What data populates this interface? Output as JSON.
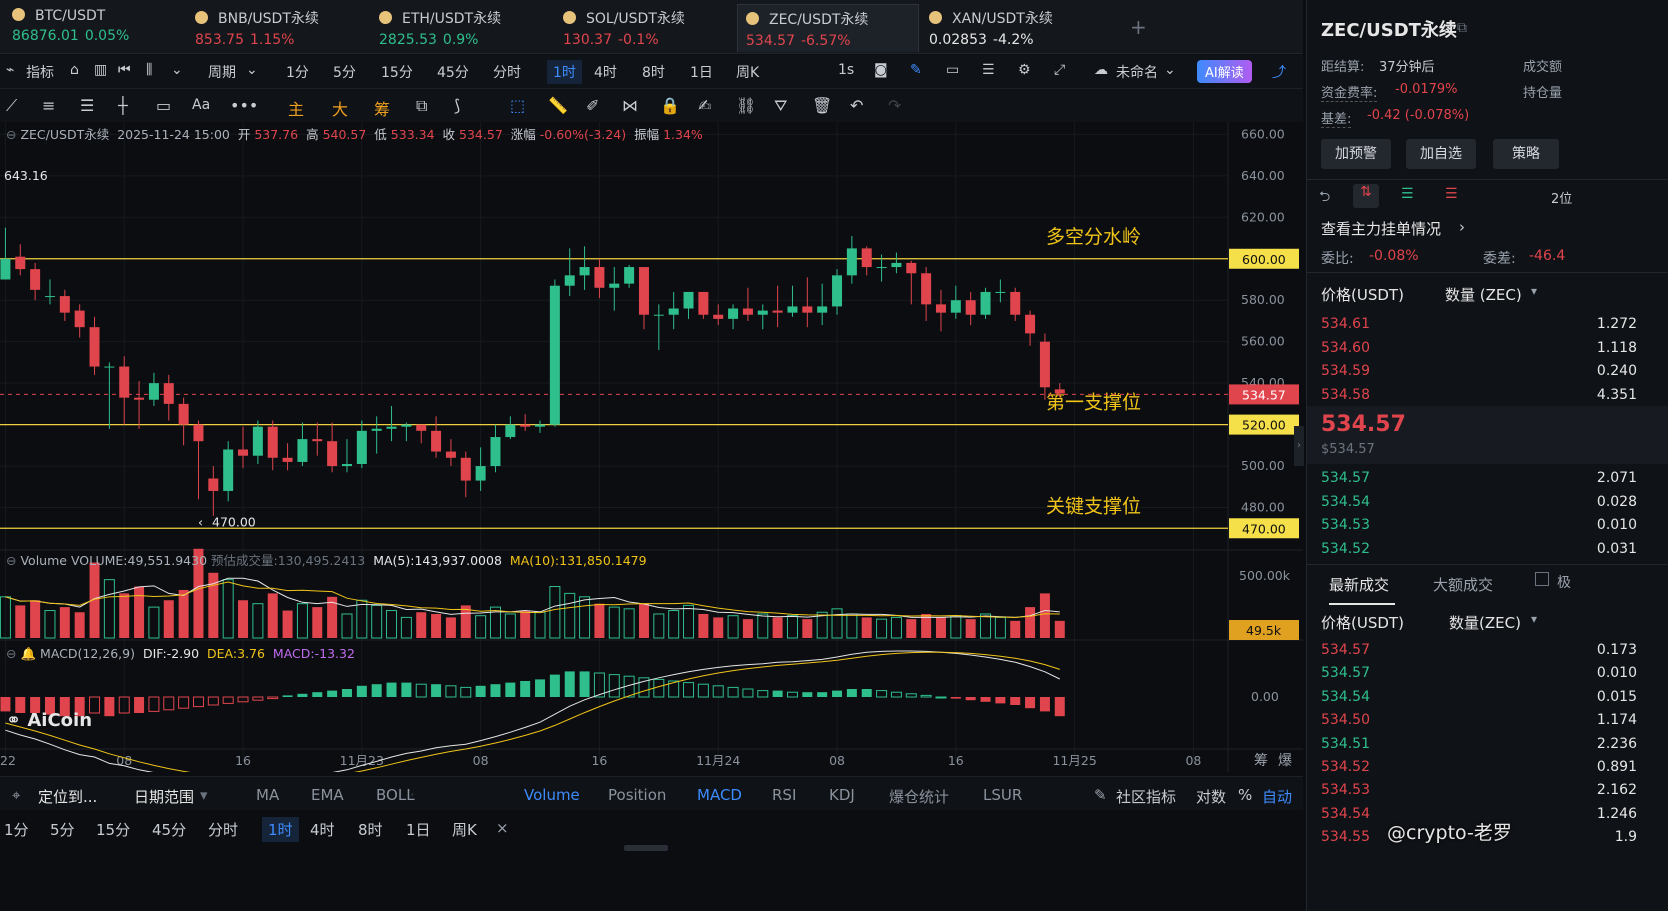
{
  "tabs": [
    {
      "name": "BTC/USDT",
      "price": "86876.01",
      "change": "0.05%",
      "dir": "g"
    },
    {
      "name": "BNB/USDT永续",
      "price": "853.75",
      "change": "1.15%",
      "dir": "r"
    },
    {
      "name": "ETH/USDT永续",
      "price": "2825.53",
      "change": "0.9%",
      "dir": "g"
    },
    {
      "name": "SOL/USDT永续",
      "price": "130.37",
      "change": "-0.1%",
      "dir": "r"
    },
    {
      "name": "ZEC/USDT永续",
      "price": "534.57",
      "change": "-6.57%",
      "dir": "r"
    },
    {
      "name": "XAN/USDT永续",
      "price": "0.02853",
      "change": "-4.2%",
      "dir": "w"
    }
  ],
  "toolbar": {
    "indicators": "指标",
    "period": "周期",
    "timeframes": [
      "1分",
      "5分",
      "15分",
      "45分",
      "分时",
      "1时",
      "4时",
      "8时",
      "1日",
      "周K"
    ],
    "active_timeframe": "1时",
    "seconds": "1s",
    "layout_name": "未命名",
    "ai_button": "AI解读"
  },
  "drawbar": {
    "main": "主",
    "big": "大",
    "chip": "筹",
    "font": "Aa"
  },
  "info": {
    "symbol": "ZEC/USDT永续",
    "datetime": "2025-11-24 15:00",
    "open_label": "开",
    "open": "537.76",
    "high_label": "高",
    "high": "540.57",
    "low_label": "低",
    "low": "533.34",
    "close_label": "收",
    "close": "534.57",
    "chg_label": "涨幅",
    "chg": "-0.60%(-3.24)",
    "amp_label": "振幅",
    "amp": "1.34%"
  },
  "volume_info": {
    "label": "Volume",
    "vol": "VOLUME:49,551.9430",
    "est": "预估成交量:130,495.2413",
    "ma5": "MA(5):143,937.0008",
    "ma10": "MA(10):131,850.1479",
    "axis_max": "500.00k",
    "current": "49.5k"
  },
  "macd_info": {
    "label": "MACD(12,26,9)",
    "dif": "DIF:-2.90",
    "dea": "DEA:3.76",
    "macd": "MACD:-13.32",
    "zero": "0.00"
  },
  "watermark": "AiCoin",
  "credit": "@crypto-老罗",
  "chart_data": {
    "type": "candlestick",
    "interval": "1h",
    "ylim": [
      460,
      665
    ],
    "yticks": [
      660,
      640,
      620,
      600,
      580,
      560,
      540,
      520,
      500,
      480
    ],
    "ytick_labels": [
      "660.00",
      "640.00",
      "620.00",
      "600.00",
      "580.00",
      "560.00",
      "540.00",
      "520.00",
      "500.00",
      "480.00"
    ],
    "xticks": [
      {
        "i": 0,
        "label": "22"
      },
      {
        "i": 8,
        "label": "08"
      },
      {
        "i": 16,
        "label": "16"
      },
      {
        "i": 24,
        "label": "11月23"
      },
      {
        "i": 32,
        "label": "08"
      },
      {
        "i": 40,
        "label": "16"
      },
      {
        "i": 48,
        "label": "11月24"
      },
      {
        "i": 56,
        "label": "08"
      },
      {
        "i": 64,
        "label": "16"
      },
      {
        "i": 72,
        "label": "11月25"
      },
      {
        "i": 80,
        "label": "08"
      }
    ],
    "candles": [
      [
        590,
        600,
        596,
        615
      ],
      [
        601,
        595,
        592,
        607
      ],
      [
        595,
        585,
        580,
        598
      ],
      [
        582,
        582,
        578,
        590
      ],
      [
        582,
        574,
        570,
        585
      ],
      [
        575,
        567,
        562,
        578
      ],
      [
        567,
        548,
        544,
        572
      ],
      [
        548,
        548,
        518,
        550
      ],
      [
        548,
        533,
        520,
        553
      ],
      [
        533,
        532,
        518,
        541
      ],
      [
        532,
        540,
        529,
        545
      ],
      [
        540,
        530,
        522,
        544
      ],
      [
        530,
        520,
        510,
        533
      ],
      [
        520,
        512,
        484,
        522
      ],
      [
        494,
        488,
        476,
        500
      ],
      [
        488,
        508,
        483,
        512
      ],
      [
        508,
        505,
        499,
        519
      ],
      [
        505,
        519,
        501,
        522
      ],
      [
        519,
        504,
        498,
        522
      ],
      [
        504,
        502,
        498,
        511
      ],
      [
        502,
        513,
        500,
        521
      ],
      [
        513,
        512,
        505,
        521
      ],
      [
        512,
        500,
        497,
        521
      ],
      [
        500,
        501,
        497,
        513
      ],
      [
        501,
        517,
        499,
        522
      ],
      [
        517,
        518,
        506,
        524
      ],
      [
        518,
        519,
        512,
        529
      ],
      [
        519,
        520,
        512,
        521
      ],
      [
        520,
        517,
        511,
        520
      ],
      [
        517,
        507,
        504,
        524
      ],
      [
        507,
        504,
        500,
        513
      ],
      [
        504,
        493,
        485,
        507
      ],
      [
        493,
        500,
        488,
        509
      ],
      [
        500,
        514,
        497,
        520
      ],
      [
        514,
        520,
        513,
        524
      ],
      [
        520,
        519,
        517,
        525
      ],
      [
        519,
        520,
        516,
        522
      ],
      [
        520,
        587,
        519,
        590
      ],
      [
        587,
        592,
        582,
        605
      ],
      [
        592,
        596,
        585,
        606
      ],
      [
        596,
        586,
        581,
        600
      ],
      [
        586,
        588,
        575,
        596
      ],
      [
        588,
        596,
        586,
        597
      ],
      [
        596,
        573,
        566,
        596
      ],
      [
        573,
        573,
        556,
        578
      ],
      [
        573,
        576,
        566,
        584
      ],
      [
        576,
        584,
        571,
        584
      ],
      [
        584,
        573,
        571,
        584
      ],
      [
        573,
        571,
        568,
        578
      ],
      [
        571,
        576,
        566,
        578
      ],
      [
        576,
        573,
        570,
        586
      ],
      [
        573,
        575,
        566,
        578
      ],
      [
        575,
        574,
        567,
        587
      ],
      [
        574,
        577,
        572,
        587
      ],
      [
        577,
        574,
        567,
        591
      ],
      [
        574,
        577,
        568,
        588
      ],
      [
        577,
        592,
        573,
        595
      ],
      [
        592,
        605,
        588,
        611
      ],
      [
        605,
        596,
        592,
        606
      ],
      [
        596,
        596,
        589,
        602
      ],
      [
        596,
        598,
        593,
        603
      ],
      [
        598,
        593,
        578,
        599
      ],
      [
        593,
        578,
        570,
        596
      ],
      [
        578,
        574,
        565,
        585
      ],
      [
        574,
        580,
        571,
        587
      ],
      [
        580,
        573,
        568,
        584
      ],
      [
        573,
        584,
        571,
        586
      ],
      [
        584,
        584,
        579,
        590
      ],
      [
        584,
        573,
        570,
        586
      ],
      [
        573,
        564,
        558,
        575
      ],
      [
        560,
        538,
        532,
        564
      ],
      [
        537,
        535,
        533,
        540
      ]
    ],
    "price_lines": [
      {
        "value": 600,
        "label": "600.00",
        "name": "多空分水岭"
      },
      {
        "value": 520,
        "label": "520.00",
        "name": "第一支撑位"
      },
      {
        "value": 470,
        "label": "470.00",
        "name": "关键支撑位"
      }
    ],
    "current_price": {
      "value": 534.57,
      "label": "534.57"
    },
    "annotations": {
      "high_mark": "643.16",
      "low_mark": "470.00"
    },
    "volume": [
      120,
      95,
      110,
      80,
      90,
      75,
      220,
      170,
      130,
      150,
      90,
      110,
      140,
      260,
      190,
      170,
      110,
      100,
      130,
      80,
      100,
      90,
      120,
      70,
      110,
      95,
      80,
      60,
      75,
      70,
      60,
      95,
      65,
      90,
      70,
      80,
      75,
      150,
      130,
      120,
      100,
      90,
      85,
      100,
      70,
      80,
      95,
      70,
      60,
      65,
      55,
      70,
      60,
      65,
      55,
      75,
      85,
      70,
      60,
      55,
      60,
      55,
      70,
      60,
      65,
      55,
      70,
      60,
      50,
      90,
      130,
      50
    ],
    "macd_hist": [
      -9,
      -10,
      -10,
      -11,
      -12,
      -12,
      -10,
      -12,
      -10,
      -10,
      -9,
      -8,
      -7,
      -6,
      -5,
      -4,
      -3,
      -2,
      -1,
      1,
      2,
      3,
      4,
      5,
      7,
      8,
      9,
      9,
      8,
      8,
      7,
      6,
      7,
      8,
      9,
      10,
      11,
      14,
      16,
      16,
      15,
      14,
      13,
      12,
      11,
      10,
      9,
      8,
      7,
      6,
      5,
      4,
      4,
      3,
      3,
      3,
      4,
      5,
      5,
      4,
      3,
      2,
      1,
      0,
      -1,
      -2,
      -3,
      -4,
      -5,
      -7,
      -9,
      -12
    ]
  },
  "right": {
    "title": "ZEC/USDT永续",
    "settle_label": "距结算:",
    "settle": "37分钟后",
    "vol_label": "成交额",
    "funding_label": "资金费率:",
    "funding": "-0.0179%",
    "oi_label": "持仓量",
    "basis_label": "基差:",
    "basis": "-0.42 (-0.078%)",
    "btn_alert": "加预警",
    "btn_fav": "加自选",
    "btn_strategy": "策略",
    "depth_label": "2位",
    "main_orders": "查看主力挂单情况",
    "ratio_label": "委比:",
    "ratio": "-0.08%",
    "diff_label": "委差:",
    "diff": "-46.4",
    "price_col": "价格(USDT)",
    "qty_col": "数量 (ZEC)",
    "asks": [
      [
        "534.61",
        "1.272"
      ],
      [
        "534.60",
        "1.118"
      ],
      [
        "534.59",
        "0.240"
      ],
      [
        "534.58",
        "4.351"
      ]
    ],
    "last": "534.57",
    "last_sub": "$534.57",
    "bids": [
      [
        "534.57",
        "2.071"
      ],
      [
        "534.54",
        "0.028"
      ],
      [
        "534.53",
        "0.010"
      ],
      [
        "534.52",
        "0.031"
      ]
    ],
    "trades_tab": "最新成交",
    "big_tab": "大额成交",
    "extreme": "极",
    "trade_price_col": "价格(USDT)",
    "trade_qty_col": "数量(ZEC)",
    "trades": [
      [
        "534.57",
        "0.173",
        "r"
      ],
      [
        "534.57",
        "0.010",
        "g"
      ],
      [
        "534.54",
        "0.015",
        "g"
      ],
      [
        "534.50",
        "1.174",
        "r"
      ],
      [
        "534.51",
        "2.236",
        "g"
      ],
      [
        "534.52",
        "0.891",
        "r"
      ],
      [
        "534.53",
        "2.162",
        "r"
      ],
      [
        "534.54",
        "1.246",
        "r"
      ],
      [
        "534.55",
        "1.9",
        "r"
      ]
    ]
  },
  "bottom": {
    "locate": "定位到...",
    "range": "日期范围",
    "indicators": [
      "MA",
      "EMA",
      "BOLL"
    ],
    "sub_indicators": [
      "Volume",
      "Position",
      "MACD",
      "RSI",
      "KDJ",
      "爆仓统计",
      "LSUR"
    ],
    "community": "社区指标",
    "log": "对数",
    "pct": "%",
    "auto": "自动",
    "timeframes": [
      "1分",
      "5分",
      "15分",
      "45分",
      "分时",
      "1时",
      "4时",
      "8时",
      "1日",
      "周K"
    ],
    "active": "1时",
    "right_labels": [
      "筹",
      "爆"
    ]
  }
}
